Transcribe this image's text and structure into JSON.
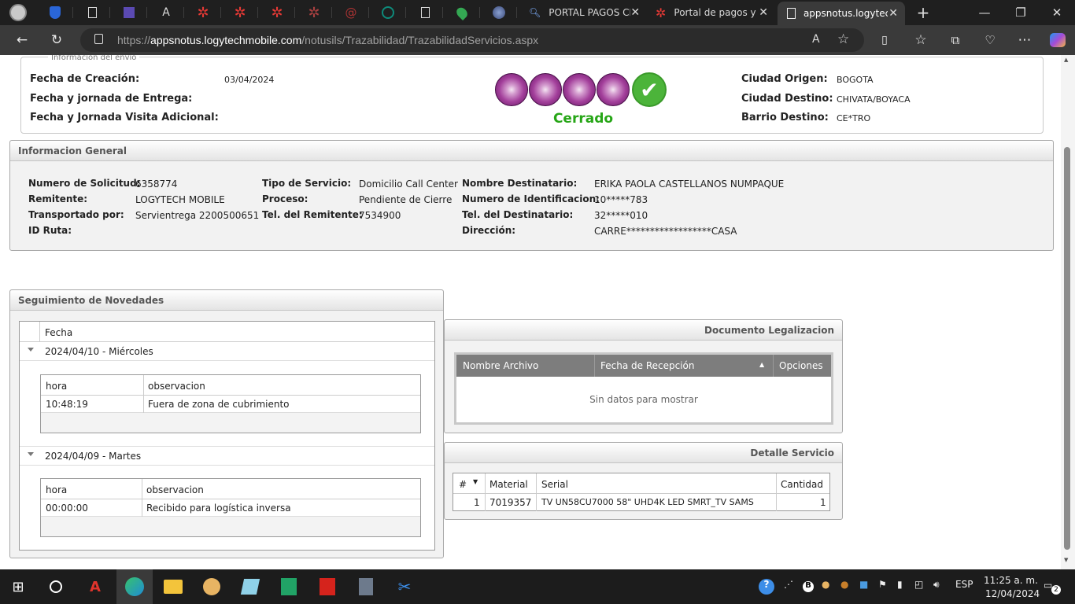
{
  "browser": {
    "pinned_tab_icons": [
      "profile-avatar-icon",
      "shield-icon",
      "document-icon",
      "list-icon",
      "letter-a-icon",
      "red-star-icon",
      "red-star-icon",
      "red-star-icon",
      "red-star-icon",
      "at-sign-icon",
      "circle-logo-icon",
      "document-icon",
      "map-pin-icon",
      "globe-icon"
    ],
    "tabs": [
      {
        "title": "PORTAL PAGOS CL",
        "icon": "search-icon",
        "close": "✕"
      },
      {
        "title": "Portal de pagos y r",
        "icon": "red-star-icon",
        "close": "✕"
      },
      {
        "title": "appsnotus.logytec",
        "icon": "document-icon",
        "close": "✕",
        "active": true
      }
    ],
    "new_tab": "+",
    "window_controls": [
      "—",
      "❐",
      "✕"
    ],
    "url_prefix": "https://",
    "url_host": "appsnotus.logytechmobile.com",
    "url_path": "/notusils/Trazabilidad/TrazabilidadServicios.aspx"
  },
  "envio": {
    "legend": "Informacion del envío",
    "fecha_creacion_label": "Fecha de Creación:",
    "fecha_creacion": "03/04/2024",
    "fecha_entrega_label": "Fecha y jornada de Entrega:",
    "fecha_visita_label": "Fecha y Jornada Visita Adicional:",
    "estado": "Cerrado",
    "ciudad_origen_label": "Ciudad Origen:",
    "ciudad_origen": "BOGOTA",
    "ciudad_destino_label": "Ciudad Destino:",
    "ciudad_destino": "CHIVATA/BOYACA",
    "barrio_destino_label": "Barrio Destino:",
    "barrio_destino": "CE*TRO"
  },
  "general": {
    "title": "Informacion General",
    "numero_solicitud_label": "Numero de Solicitud:",
    "numero_solicitud": "6358774",
    "remitente_label": "Remitente:",
    "remitente": "LOGYTECH MOBILE",
    "transportado_label": "Transportado por:",
    "transportado": "Servientrega 2200500651",
    "id_ruta_label": "ID Ruta:",
    "tipo_servicio_label": "Tipo de Servicio:",
    "tipo_servicio": "Domicilio Call Center",
    "proceso_label": "Proceso:",
    "proceso": "Pendiente de Cierre",
    "tel_remitente_label": "Tel. del Remitente:",
    "tel_remitente": "7534900",
    "nombre_dest_label": "Nombre Destinatario:",
    "nombre_dest": "ERIKA PAOLA CASTELLANOS NUMPAQUE",
    "num_ident_label": "Numero de Identificacion:",
    "num_ident": "10*****783",
    "tel_dest_label": "Tel. del Destinatario:",
    "tel_dest": "32*****010",
    "direccion_label": "Dirección:",
    "direccion": "CARRE******************CASA"
  },
  "seguimiento": {
    "title": "Seguimiento de Novedades",
    "col_fecha": "Fecha",
    "groups": [
      {
        "fecha": "2024/04/10 - Miércoles",
        "col_hora": "hora",
        "col_obs": "observacion",
        "hora": "10:48:19",
        "obs": "Fuera de zona de cubrimiento"
      },
      {
        "fecha": "2024/04/09 - Martes",
        "col_hora": "hora",
        "col_obs": "observacion",
        "hora": "00:00:00",
        "obs": "Recibido para logística inversa"
      }
    ]
  },
  "legalizacion": {
    "title": "Documento Legalizacion",
    "col_nombre": "Nombre Archivo",
    "col_fecha": "Fecha de Recepción",
    "col_opciones": "Opciones",
    "empty": "Sin datos para mostrar"
  },
  "detalle": {
    "title": "Detalle Servicio",
    "col_num": "#",
    "col_material": "Material",
    "col_serial": "Serial",
    "col_cantidad": "Cantidad",
    "row": {
      "num": "1",
      "material": "7019357",
      "serial": "TV UN58CU7000 58\" UHD4K LED SMRT_TV SAMS",
      "cantidad": "1"
    }
  },
  "taskbar": {
    "apps": [
      "windows-start-icon",
      "search-icon",
      "acrobat-icon",
      "edge-icon",
      "file-explorer-icon",
      "app-icon",
      "notes-icon",
      "spreadsheet-icon",
      "pdf-icon",
      "calculator-icon",
      "snipping-icon"
    ],
    "lang": "ESP",
    "time": "11:25 a. m.",
    "date": "12/04/2024",
    "notifications": "2"
  }
}
